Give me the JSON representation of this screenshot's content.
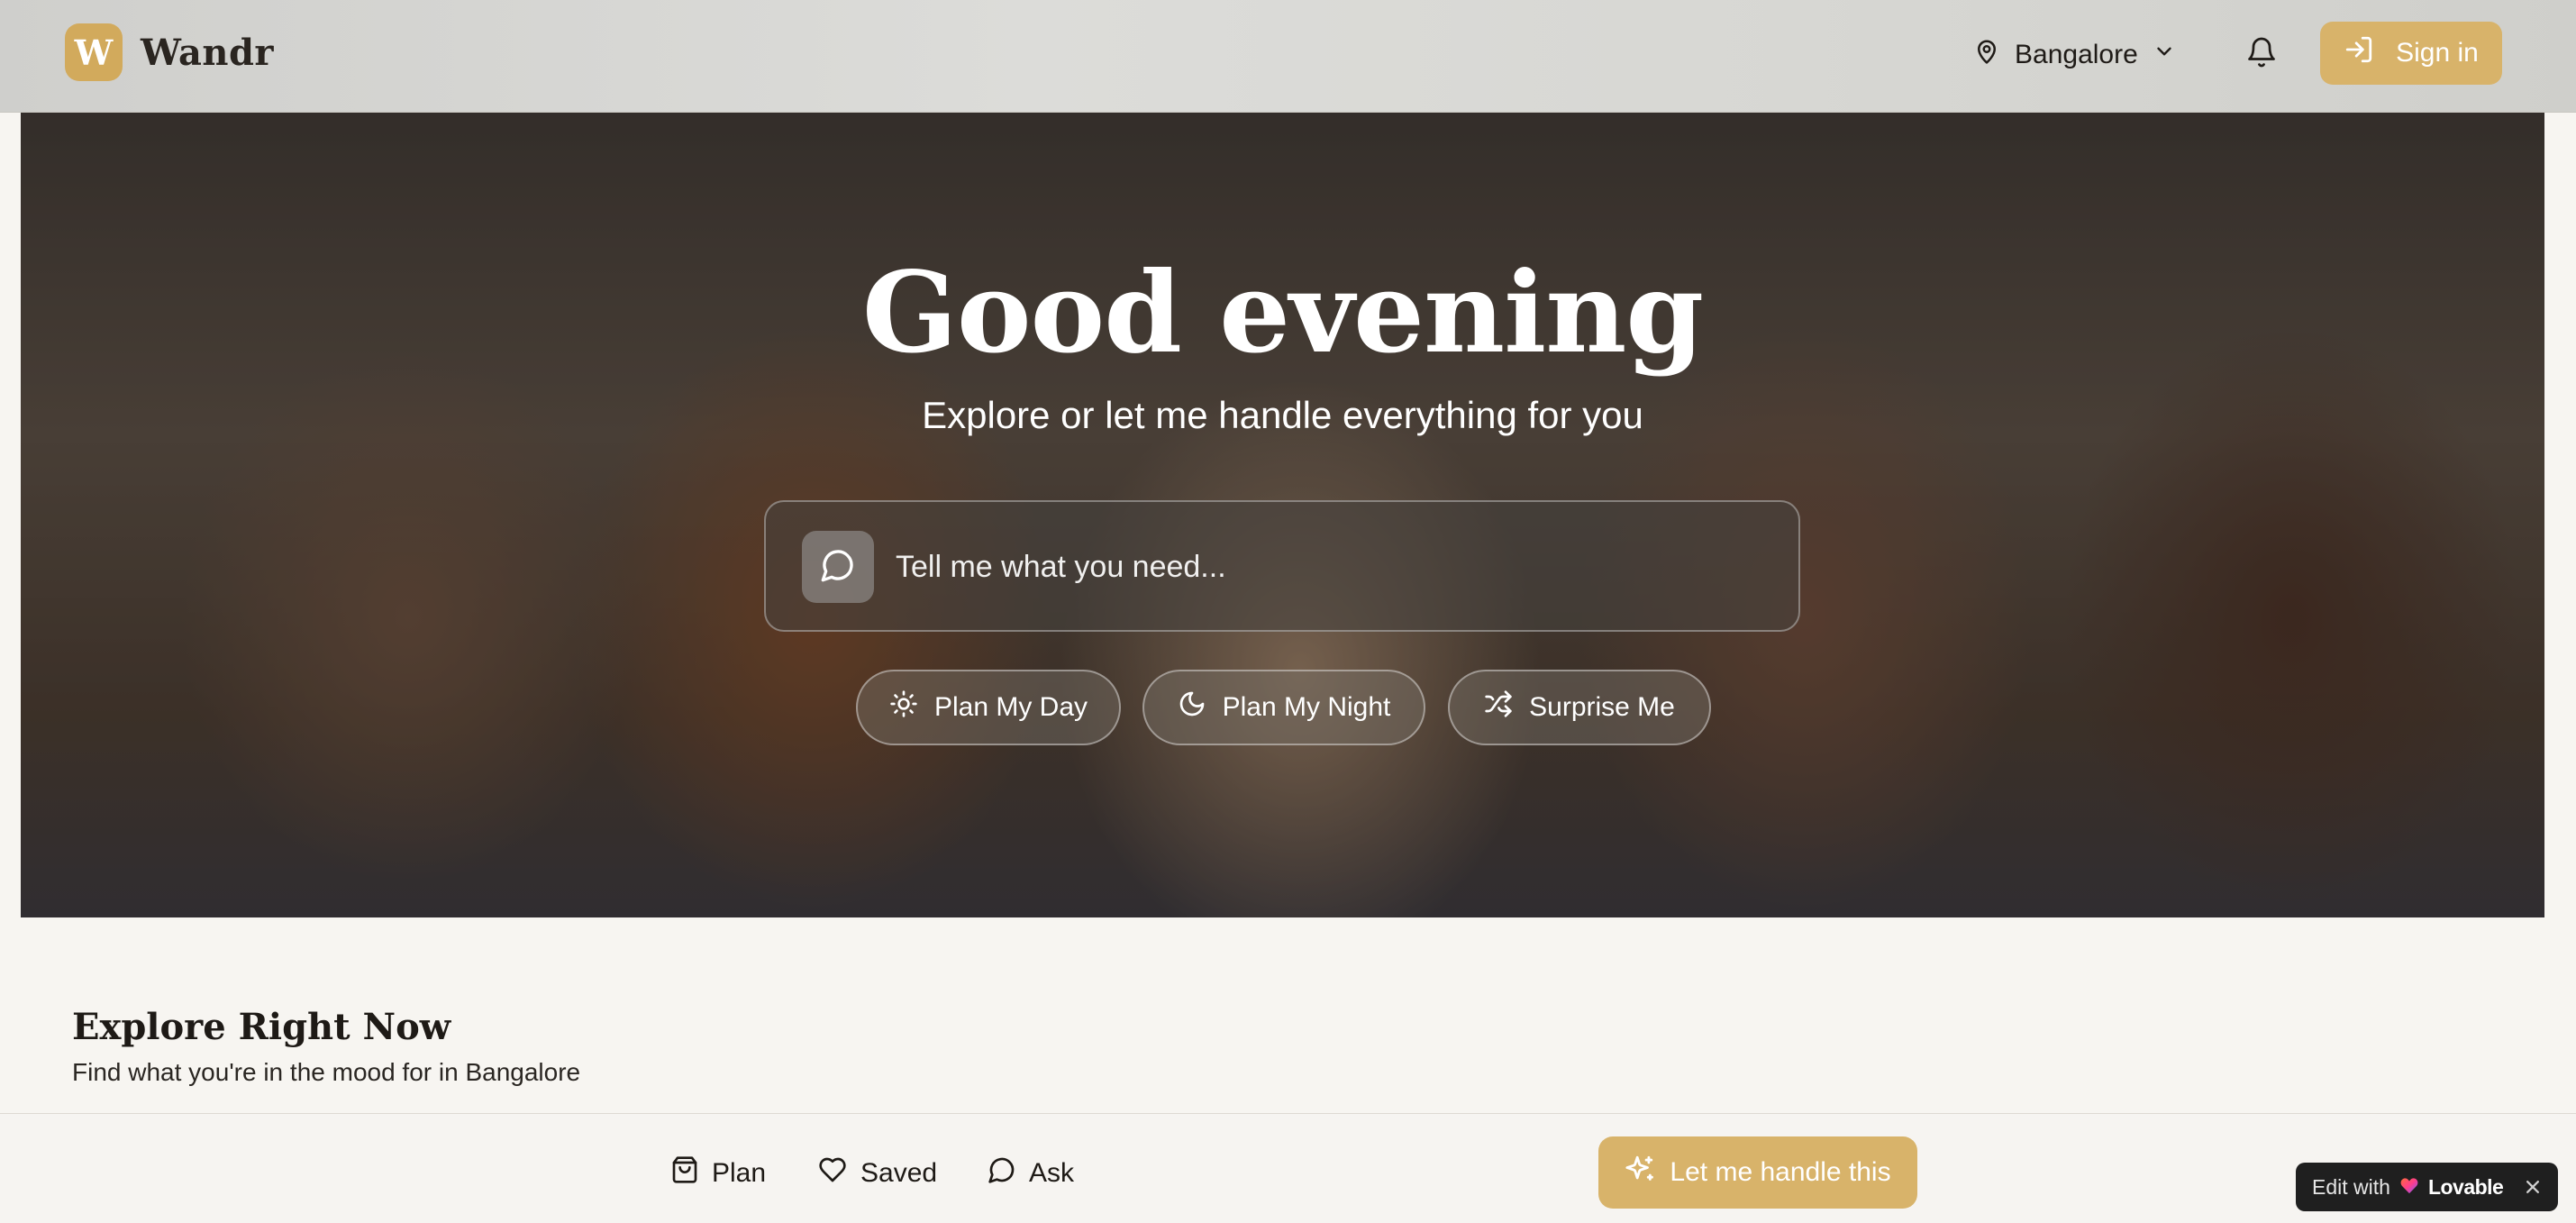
{
  "header": {
    "logo_letter": "W",
    "brand": "Wandr",
    "location": "Bangalore",
    "sign_in_label": "Sign in"
  },
  "hero": {
    "title": "Good evening",
    "subtitle": "Explore or let me handle everything for you",
    "ask_placeholder": "Tell me what you need...",
    "pills": [
      {
        "label": "Plan My Day",
        "icon": "sun-icon"
      },
      {
        "label": "Plan My Night",
        "icon": "moon-icon"
      },
      {
        "label": "Surprise Me",
        "icon": "shuffle-icon"
      }
    ]
  },
  "explore": {
    "title": "Explore Right Now",
    "subtitle": "Find what you're in the mood for in Bangalore"
  },
  "bottom_nav": {
    "items": [
      {
        "label": "Plan",
        "icon": "shopping-bag-icon"
      },
      {
        "label": "Saved",
        "icon": "heart-icon"
      },
      {
        "label": "Ask",
        "icon": "chat-bubble-icon"
      }
    ],
    "cta_label": "Let me handle this"
  },
  "badge": {
    "prefix": "Edit with",
    "brand": "Lovable"
  },
  "colors": {
    "accent": "#d8b36a",
    "logo_bg": "#d2aa5c",
    "page_bg": "#f7f5f1",
    "badge_bg": "#1f1f1f"
  }
}
